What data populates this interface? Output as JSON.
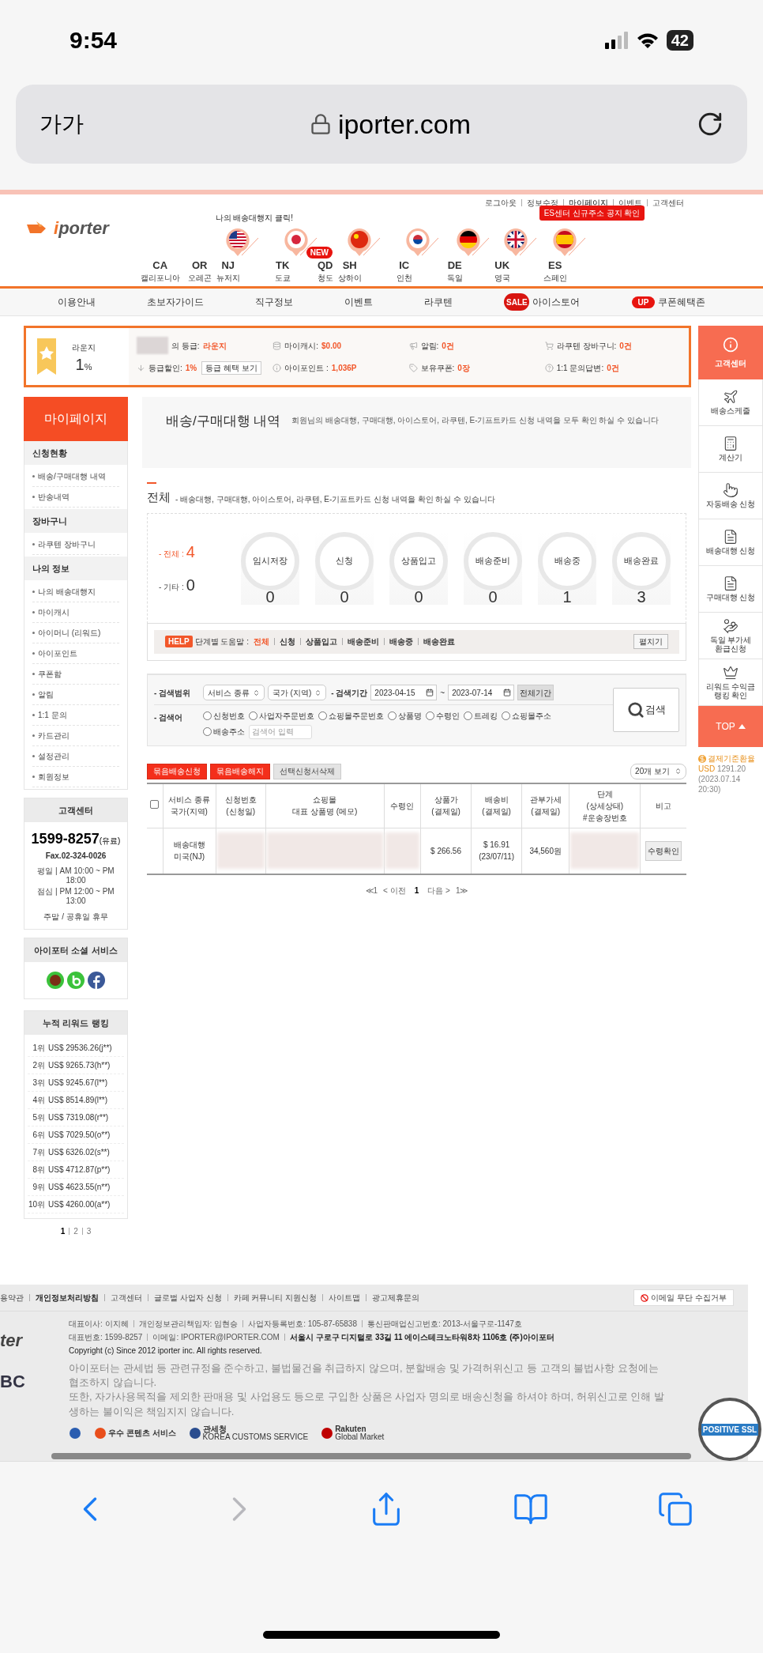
{
  "status_bar": {
    "time": "9:54",
    "battery": "42"
  },
  "browser": {
    "text_size": "가가",
    "url": "iporter.com"
  },
  "top_links": [
    "로그아웃",
    "정보수정",
    "마이페이지",
    "이벤트",
    "고객센터"
  ],
  "logo": "iporter",
  "destinations_hint": "나의 배송대행지 클릭!",
  "notice_bubble": "ES센터 신규주소 공지 확인",
  "destinations": [
    {
      "code": "CA",
      "name": "캘리포니아",
      "kind": "plain"
    },
    {
      "code": "OR",
      "name": "오레곤",
      "kind": "plain"
    },
    {
      "code": "NJ",
      "name": "뉴저지",
      "kind": "us"
    },
    {
      "code": "TK",
      "name": "도쿄",
      "kind": "jp"
    },
    {
      "code": "QD",
      "name": "청도",
      "kind": "plain",
      "badge": "NEW"
    },
    {
      "code": "SH",
      "name": "상하이",
      "kind": "cn"
    },
    {
      "code": "IC",
      "name": "인천",
      "kind": "kr"
    },
    {
      "code": "DE",
      "name": "독일",
      "kind": "de"
    },
    {
      "code": "UK",
      "name": "영국",
      "kind": "uk"
    },
    {
      "code": "ES",
      "name": "스페인",
      "kind": "es"
    }
  ],
  "nav": [
    {
      "label": "이용안내"
    },
    {
      "label": "초보자가이드"
    },
    {
      "label": "직구정보"
    },
    {
      "label": "이벤트"
    },
    {
      "label": "라쿠텐"
    },
    {
      "label": "아이스토어",
      "badge": "SALE"
    },
    {
      "label": "쿠폰혜택존",
      "badge": "UP"
    }
  ],
  "grade": {
    "name": "라운지",
    "rate": "1",
    "unit": "%"
  },
  "member_stats": [
    {
      "label": "의 등급:",
      "value": "라운지",
      "masked": true
    },
    {
      "label": "마이캐시:",
      "value": "$0.00"
    },
    {
      "label": "알림:",
      "value": "0건"
    },
    {
      "label": "라쿠텐 장바구니:",
      "value": "0건"
    },
    {
      "label": "등급할인:",
      "value": "1%",
      "button": "등급 혜택 보기"
    },
    {
      "label": "아이포인트 :",
      "value": "1,036P"
    },
    {
      "label": "보유쿠폰:",
      "value": "0장"
    },
    {
      "label": "1:1 문의답변:",
      "value": "0건"
    }
  ],
  "sidebar": {
    "title": "마이페이지",
    "sections": [
      {
        "title": "신청현황",
        "items": [
          "배송/구매대행 내역",
          "반송내역"
        ]
      },
      {
        "title": "장바구니",
        "items": [
          "라쿠텐 장바구니"
        ]
      },
      {
        "title": "나의 정보",
        "items": [
          "나의 배송대행지",
          "마이캐시",
          "아이머니 (리워드)",
          "아이포인트",
          "쿠폰함",
          "알림",
          "1:1 문의",
          "카드관리",
          "설정관리",
          "회원정보"
        ]
      }
    ]
  },
  "customer_center": {
    "title": "고객센터",
    "phone": "1599-8257",
    "phone_note": "(유료)",
    "fax": "Fax.02-324-0026",
    "hours": [
      "평일 | AM 10:00 ~ PM 18:00",
      "점심 | PM 12:00 ~ PM 13:00"
    ],
    "closed": "주말 / 공휴일 휴무"
  },
  "social": {
    "title": "아이포터 소셜 서비스"
  },
  "ranking": {
    "title": "누적 리워드 랭킹",
    "rows": [
      {
        "rank": "1위",
        "amount": "US$ 29536.26(j**)"
      },
      {
        "rank": "2위",
        "amount": "US$ 9265.73(h**)"
      },
      {
        "rank": "3위",
        "amount": "US$ 9245.67(l**)"
      },
      {
        "rank": "4위",
        "amount": "US$ 8514.89(l**)"
      },
      {
        "rank": "5위",
        "amount": "US$ 7319.08(r**)"
      },
      {
        "rank": "6위",
        "amount": "US$ 7029.50(o**)"
      },
      {
        "rank": "7위",
        "amount": "US$ 6326.02(s**)"
      },
      {
        "rank": "8위",
        "amount": "US$ 4712.87(p**)"
      },
      {
        "rank": "9위",
        "amount": "US$ 4623.55(n**)"
      },
      {
        "rank": "10위",
        "amount": "US$ 4260.00(a**)"
      }
    ],
    "pages": [
      {
        "label": "1",
        "selected": true
      },
      {
        "label": "2",
        "selected": false
      },
      {
        "label": "3",
        "selected": false
      }
    ]
  },
  "page_title": "배송/구매대행 내역",
  "page_desc": "회원님의 배송대행, 구매대행, 아이스토어, 라쿠텐, E-기프트카드 신청 내역을 모두 확인 하실 수 있습니다",
  "summary": {
    "title": "전체",
    "desc": "- 배송대행, 구매대행, 아이스토어, 라쿠텐, E-기프트카드 신청 내역을 확인 하실 수 있습니다",
    "totals": [
      {
        "label": "- 전체 :",
        "value": "4",
        "highlight": true
      },
      {
        "label": "- 기타 :",
        "value": "0",
        "highlight": false
      }
    ],
    "stages": [
      {
        "label": "임시저장",
        "count": "0"
      },
      {
        "label": "신청",
        "count": "0"
      },
      {
        "label": "상품입고",
        "count": "0"
      },
      {
        "label": "배송준비",
        "count": "0"
      },
      {
        "label": "배송중",
        "count": "1"
      },
      {
        "label": "배송완료",
        "count": "3"
      }
    ]
  },
  "help": {
    "badge": "HELP",
    "label": "단계별 도움말 :",
    "links": [
      {
        "label": "전체",
        "selected": true
      },
      {
        "label": "신청",
        "selected": false
      },
      {
        "label": "상품입고",
        "selected": false
      },
      {
        "label": "배송준비",
        "selected": false
      },
      {
        "label": "배송중",
        "selected": false
      },
      {
        "label": "배송완료",
        "selected": false
      }
    ],
    "button": "펼치기"
  },
  "search": {
    "scope_label": "- 검색범위",
    "selects": [
      "서비스 종류",
      "국가 (지역)"
    ],
    "period_label": "- 검색기간",
    "from": "2023-04-15",
    "sep": "~",
    "to": "2023-07-14",
    "all_period": "전체기간",
    "keyword_label": "- 검색어",
    "radios": [
      {
        "label": "신청번호",
        "selected": false
      },
      {
        "label": "사업자주문번호",
        "selected": false
      },
      {
        "label": "쇼핑몰주문번호",
        "selected": false
      },
      {
        "label": "상품명",
        "selected": false
      },
      {
        "label": "수령인",
        "selected": false
      },
      {
        "label": "트레킹",
        "selected": false
      },
      {
        "label": "쇼핑몰주소",
        "selected": false
      },
      {
        "label": "배송주소",
        "selected": false
      }
    ],
    "placeholder": "검색어 입력",
    "button": "검색"
  },
  "actions": [
    {
      "label": "묶음배송신청",
      "kind": "primary"
    },
    {
      "label": "묶음배송해지",
      "kind": "primary"
    },
    {
      "label": "선택신청서삭제",
      "kind": "secondary"
    }
  ],
  "page_size": "20개 보기",
  "table": {
    "select_all": false,
    "columns": [
      "서비스 종류\n국가(지역)",
      "신청번호\n(신청일)",
      "쇼핑몰\n대표 상품명 (메모)",
      "수령인",
      "상품가\n(결제일)",
      "배송비\n(결제일)",
      "관부가세\n(결제일)",
      "단계\n(상세상태)\n#운송장번호",
      "비고"
    ],
    "rows": [
      {
        "cells": [
          {
            "text": "배송대행\n미국(NJ)"
          },
          {
            "masked": true
          },
          {
            "masked": true
          },
          {
            "masked": true
          },
          {
            "text": "$ 266.56"
          },
          {
            "text": "$ 16.91\n(23/07/11)"
          },
          {
            "text": "34,560원"
          },
          {
            "masked": true
          },
          {
            "button": "수령확인"
          }
        ]
      }
    ]
  },
  "pagination": {
    "first": "≪1",
    "prev": "< 이전",
    "pages": [
      {
        "label": "1",
        "selected": true
      }
    ],
    "next": "다음 >",
    "last": "1≫"
  },
  "quick_menu": {
    "header": "고객센터",
    "items": [
      {
        "label": "배송스케줄",
        "kind": "plane"
      },
      {
        "label": "계산기",
        "kind": "calculator"
      },
      {
        "label": "자동배송 신청",
        "kind": "touch"
      },
      {
        "label": "배송대행 신청",
        "kind": "form"
      },
      {
        "label": "구매대행 신청",
        "kind": "form"
      },
      {
        "label": "독일 부가세\n환급신청",
        "kind": "refund"
      },
      {
        "label": "리워드 수익금\n랭킹 확인",
        "kind": "crown"
      }
    ],
    "top": "TOP"
  },
  "exchange": {
    "title": "결제기준환율",
    "currency": "USD",
    "rate": "1291.20",
    "time": "(2023.07.14 20:30)"
  },
  "footer": {
    "links": [
      {
        "label": "용약관",
        "bold": false
      },
      {
        "label": "개인정보처리방침",
        "bold": true
      },
      {
        "label": "고객센터",
        "bold": false
      },
      {
        "label": "글로벌 사업자 신청",
        "bold": false
      },
      {
        "label": "카페 커뮤니티 지원신청",
        "bold": false
      },
      {
        "label": "사이트맵",
        "bold": false
      },
      {
        "label": "광고제휴문의",
        "bold": false
      }
    ],
    "email_refuse": "이메일 무단 수집거부",
    "logo": "ter",
    "logo2": "BC",
    "info_lines": [
      [
        "대표이사: 이지혜",
        "개인정보관리책임자: 임현승",
        "사업자등록번호: 105-87-65838",
        "통신판매업신고번호: 2013-서울구로-1147호"
      ],
      [
        "대표번호: 1599-8257",
        "이메일: IPORTER@IPORTER.COM"
      ]
    ],
    "address": "서울시 구로구 디지털로 33길 11 에이스테크노타워8차 1106호 (주)아이포터",
    "copyright": "Copyright (c) Since 2012 iporter inc. All rights reserved.",
    "notices": [
      "아이포터는 관세법 등 관련규정을 준수하고, 불법물건을 취급하지 않으며, 분할배송 및 가격허위신고 등 고객의 불법사항 요청에는 협조하지 않습니다.",
      "또한, 자가사용목적을 제외한 판매용 및 사업용도 등으로 구입한 상품은 사업자 명의로 배송신청을 하셔야 하며, 허위신고로 인해 발생하는 불이익은 책임지지 않습니다."
    ],
    "certs": [
      {
        "kind": "kc"
      },
      {
        "kind": "g",
        "text": "우수 콘텐츠 서비스"
      },
      {
        "kind": "customs",
        "text": "관세청",
        "sub": "KOREA CUSTOMS SERVICE"
      },
      {
        "kind": "rakuten",
        "text": "Rakuten",
        "sub": "Global Market"
      }
    ],
    "ssl": "POSITIVE SSL"
  },
  "toolbar": [
    {
      "kind": "back",
      "disabled": false
    },
    {
      "kind": "forward",
      "disabled": true
    },
    {
      "kind": "share",
      "disabled": false
    },
    {
      "kind": "bookmarks",
      "disabled": false
    },
    {
      "kind": "tabs",
      "disabled": false
    }
  ]
}
